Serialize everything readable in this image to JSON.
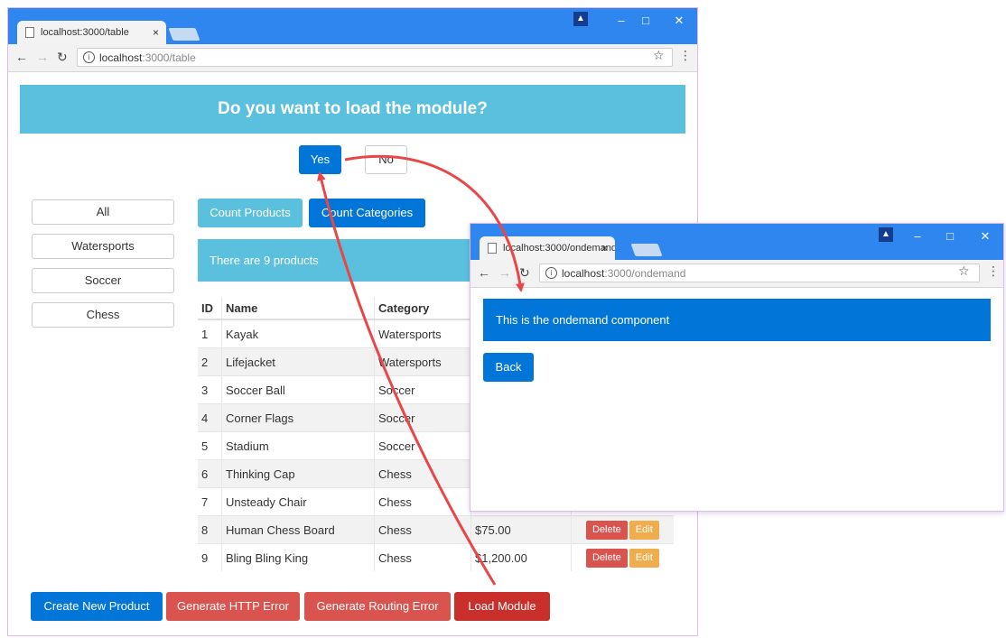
{
  "window_main": {
    "tab_title": "localhost:3000/table",
    "tab_close": "×",
    "url_host": "localhost",
    "url_path": ":3000/table",
    "banner": "Do you want to load the module?",
    "yes_label": "Yes",
    "no_label": "No",
    "categories": [
      "All",
      "Watersports",
      "Soccer",
      "Chess"
    ],
    "count_products_label": "Count Products",
    "count_categories_label": "Count Categories",
    "products_message": "There are 9 products",
    "table": {
      "headers": [
        "ID",
        "Name",
        "Category"
      ],
      "rows": [
        {
          "id": "1",
          "name": "Kayak",
          "category": "Watersports",
          "price": "",
          "actions": false
        },
        {
          "id": "2",
          "name": "Lifejacket",
          "category": "Watersports",
          "price": "",
          "actions": false
        },
        {
          "id": "3",
          "name": "Soccer Ball",
          "category": "Soccer",
          "price": "",
          "actions": false
        },
        {
          "id": "4",
          "name": "Corner Flags",
          "category": "Soccer",
          "price": "",
          "actions": false
        },
        {
          "id": "5",
          "name": "Stadium",
          "category": "Soccer",
          "price": "",
          "actions": false
        },
        {
          "id": "6",
          "name": "Thinking Cap",
          "category": "Chess",
          "price": "",
          "actions": false
        },
        {
          "id": "7",
          "name": "Unsteady Chair",
          "category": "Chess",
          "price": "",
          "actions": false
        },
        {
          "id": "8",
          "name": "Human Chess Board",
          "category": "Chess",
          "price": "$75.00",
          "actions": true
        },
        {
          "id": "9",
          "name": "Bling Bling King",
          "category": "Chess",
          "price": "$1,200.00",
          "actions": true
        }
      ],
      "delete_label": "Delete",
      "edit_label": "Edit"
    },
    "bottom_buttons": {
      "create": "Create New Product",
      "http_error": "Generate HTTP Error",
      "routing_error": "Generate Routing Error",
      "load_module": "Load Module"
    }
  },
  "window_popup": {
    "tab_title": "localhost:3000/ondemand",
    "tab_close": "×",
    "url_host": "localhost",
    "url_path": ":3000/ondemand",
    "banner": "This is the ondemand component",
    "back_label": "Back"
  },
  "colors": {
    "titlebar": "#2f86ee",
    "primary": "#0275d8",
    "info": "#5bc0de",
    "danger": "#d9534f",
    "warning": "#f0ad4e",
    "arrow": "#e8474a"
  }
}
